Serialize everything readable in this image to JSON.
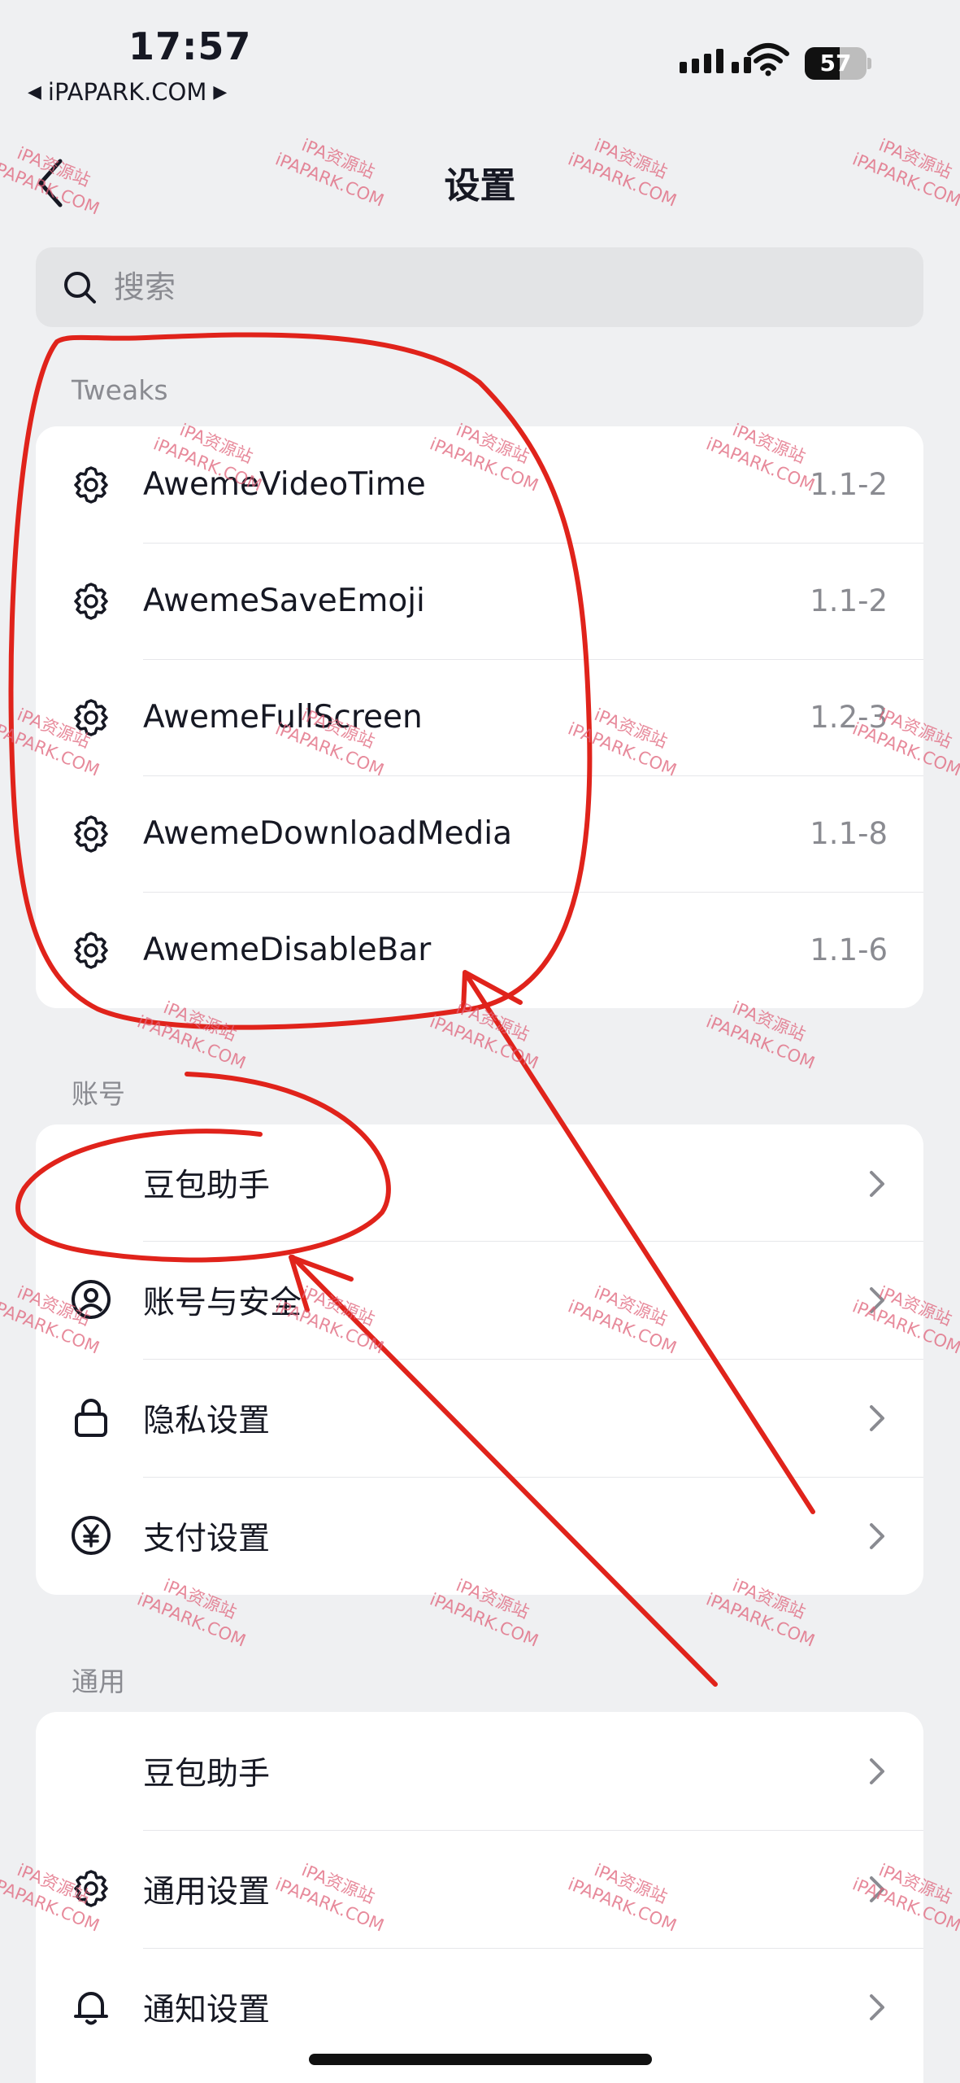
{
  "status_bar": {
    "time": "17:57",
    "back_app": "iPAPARK.COM",
    "battery": "57",
    "battery_level": 0.57
  },
  "nav": {
    "title": "设置",
    "back_icon": "chevron-left-icon"
  },
  "search": {
    "placeholder": "搜索",
    "icon": "search-icon"
  },
  "sections": {
    "tweaks": {
      "label": "Tweaks",
      "items": [
        {
          "label": "AwemeVideoTime",
          "version": "1.1-2",
          "icon": "gear-icon"
        },
        {
          "label": "AwemeSaveEmoji",
          "version": "1.1-2",
          "icon": "gear-icon"
        },
        {
          "label": "AwemeFullScreen",
          "version": "1.2-3",
          "icon": "gear-icon"
        },
        {
          "label": "AwemeDownloadMedia",
          "version": "1.1-8",
          "icon": "gear-icon"
        },
        {
          "label": "AwemeDisableBar",
          "version": "1.1-6",
          "icon": "gear-icon"
        }
      ]
    },
    "account": {
      "label": "账号",
      "items": [
        {
          "label": "豆包助手",
          "icon": ""
        },
        {
          "label": "账号与安全",
          "icon": "user-icon"
        },
        {
          "label": "隐私设置",
          "icon": "lock-icon"
        },
        {
          "label": "支付设置",
          "icon": "yuan-icon"
        }
      ]
    },
    "general": {
      "label": "通用",
      "items": [
        {
          "label": "豆包助手",
          "icon": ""
        },
        {
          "label": "通用设置",
          "icon": "gear-icon"
        },
        {
          "label": "通知设置",
          "icon": "bell-icon"
        }
      ]
    }
  },
  "watermark": {
    "line1": "iPA资源站",
    "line2": "iPAPARK.COM"
  },
  "colors": {
    "background": "#eff0f2",
    "card": "#ffffff",
    "annotation": "#e0231b",
    "watermark": "#e0637a"
  }
}
